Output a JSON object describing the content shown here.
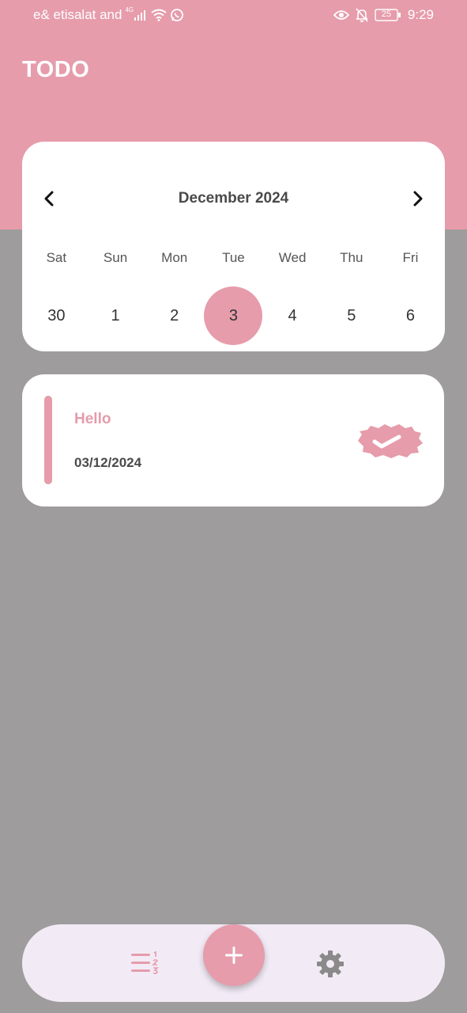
{
  "status_bar": {
    "carrier": "e& etisalat and",
    "network": "4G",
    "battery": "25",
    "time": "9:29"
  },
  "header": {
    "title": "TODO"
  },
  "calendar": {
    "month_label": "December 2024",
    "weekdays": [
      "Sat",
      "Sun",
      "Mon",
      "Tue",
      "Wed",
      "Thu",
      "Fri"
    ],
    "dates": [
      "30",
      "1",
      "2",
      "3",
      "4",
      "5",
      "6"
    ],
    "selected_date": "3",
    "prev_icon": "chevron-left-icon",
    "next_icon": "chevron-right-icon"
  },
  "tasks": [
    {
      "title": "Hello",
      "date": "03/12/2024",
      "completed": true,
      "accent_color": "#e69cab"
    }
  ],
  "bottom_nav": {
    "items": [
      {
        "icon": "ordered-list-icon",
        "active": true
      },
      {
        "icon": "gear-icon",
        "active": false
      }
    ],
    "fab_icon": "plus-icon"
  },
  "colors": {
    "primary": "#e69cab",
    "background": "#9e9c9d",
    "nav_background": "#f2ebf6",
    "card": "#ffffff"
  }
}
